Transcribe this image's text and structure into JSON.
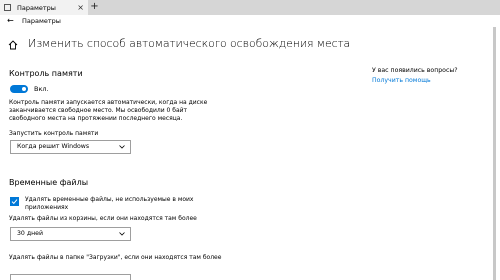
{
  "browser": {
    "tab_title": "Параметры",
    "tab_close": "×",
    "new_tab": "+"
  },
  "window": {
    "back": "←",
    "title": "Параметры"
  },
  "page": {
    "title": "Изменить способ автоматического освобождения места"
  },
  "storage_sense": {
    "heading": "Контроль памяти",
    "toggle_state": "on",
    "toggle_label": "Вкл.",
    "description_lines": [
      "Контроль памяти запускается автоматически, когда на диске",
      "заканчивается свободное место. Мы освободили 0 байт",
      "свободного места на протяжении последнего месяца."
    ],
    "run_label": "Запустить контроль памяти",
    "run_value": "Когда решит Windows"
  },
  "temp_files": {
    "heading": "Временные файлы",
    "delete_temp_checked": true,
    "delete_temp_label_lines": [
      "Удалять временные файлы, не используемые в моих",
      "приложениях"
    ],
    "recycle_label": "Удалять файлы из корзины, если они находятся там более",
    "recycle_value": "30 дней",
    "downloads_label_lines": [
      "Удалять файлы в папке \"Загрузки\", если они находятся там более"
    ],
    "downloads_value": ""
  },
  "help": {
    "question": "У вас появились вопросы?",
    "link": "Получить помощь"
  },
  "colors": {
    "accent": "#0078d7",
    "tabbar_bg": "#d6d6d6",
    "active_tab_bg": "#f2f2f2"
  },
  "icons": [
    "app-icon",
    "close-icon",
    "plus-icon",
    "back-arrow-icon",
    "home-icon",
    "chevron-down-icon",
    "checkmark-icon"
  ]
}
